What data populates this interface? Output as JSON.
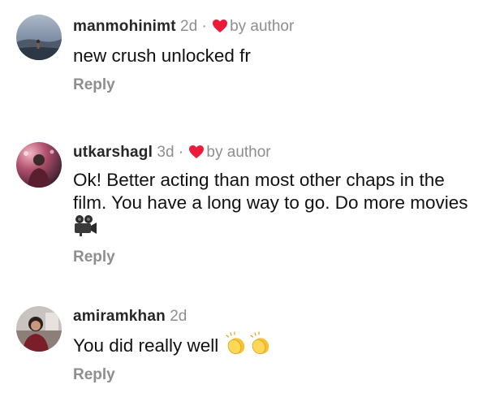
{
  "comments": [
    {
      "username": "manmohinimt",
      "time": "2d",
      "separator": "·",
      "liked_by_author": true,
      "author_label": "by author",
      "text": "new crush unlocked fr",
      "reply_label": "Reply",
      "avatar_icon": "avatar-photo"
    },
    {
      "username": "utkarshagl",
      "time": "3d",
      "separator": "·",
      "liked_by_author": true,
      "author_label": "by author",
      "text": "Ok! Better acting than most other chaps in the film. You have a long way to go. Do more movies",
      "emoji": "movie-camera-icon",
      "reply_label": "Reply",
      "avatar_icon": "avatar-photo"
    },
    {
      "username": "amiramkhan",
      "time": "2d",
      "liked_by_author": false,
      "text": "You did really well",
      "emoji": "clapping-hands-icon",
      "emoji_count": 2,
      "reply_label": "Reply",
      "avatar_icon": "avatar-photo"
    }
  ],
  "colors": {
    "heart": "#ed1b3a",
    "meta_gray": "#8e8e8e",
    "text": "#111111"
  }
}
